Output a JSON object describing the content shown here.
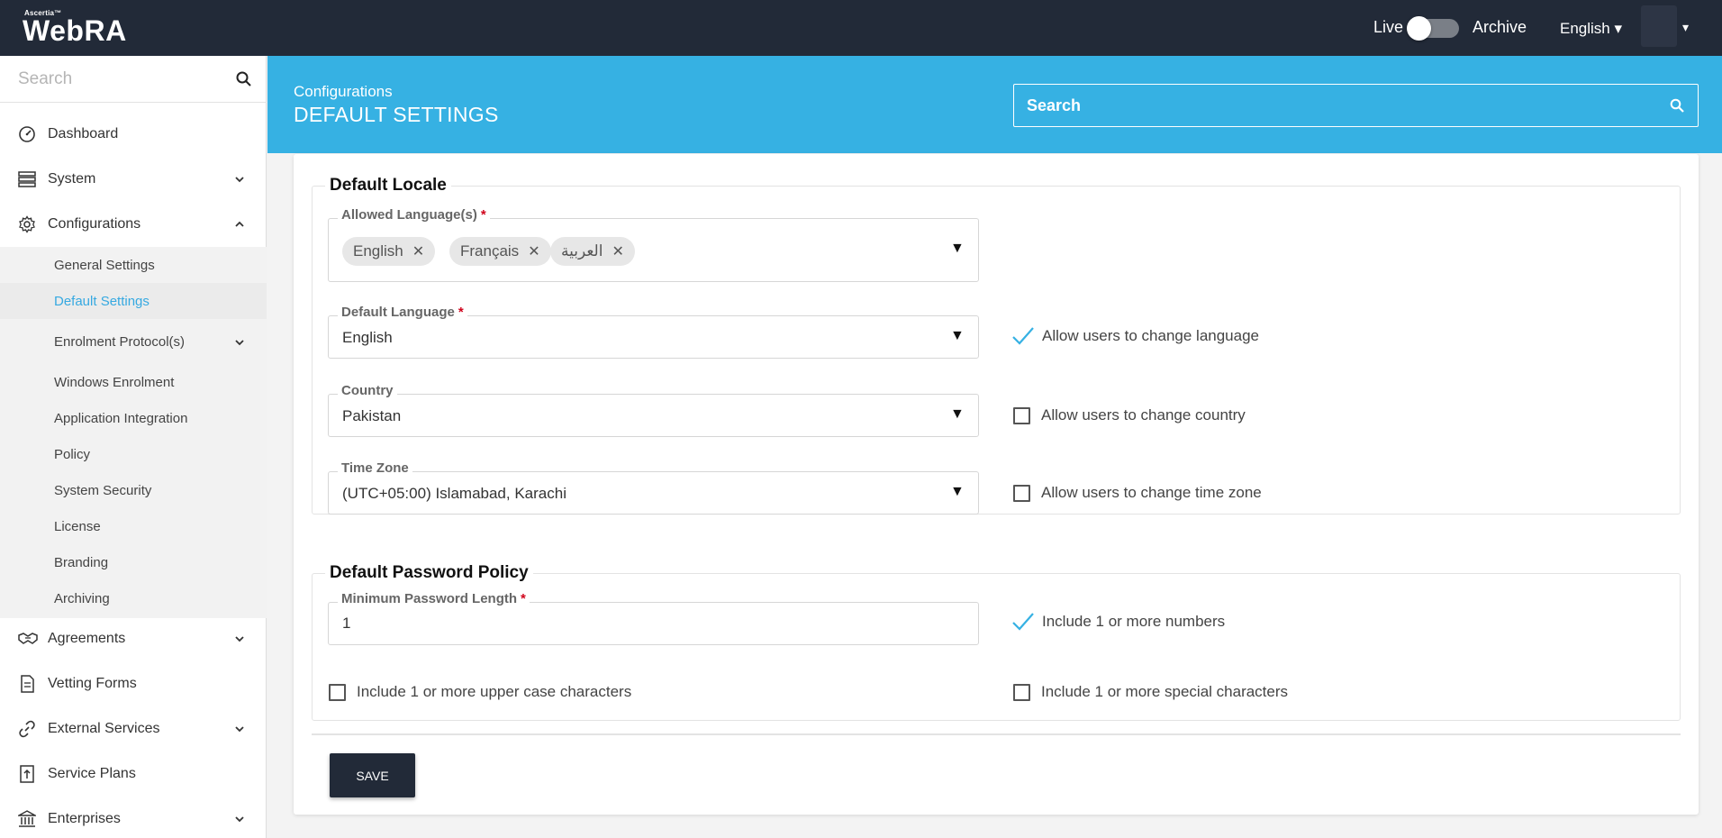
{
  "app": {
    "brand_small": "Ascertia™",
    "brand_name": "WebRA"
  },
  "topbar": {
    "live_label": "Live",
    "archive_label": "Archive",
    "language": "English ▾",
    "user_caret": "▾"
  },
  "sidebar": {
    "search_placeholder": "Search",
    "items": [
      {
        "label": "Dashboard",
        "icon": "dashboard-icon"
      },
      {
        "label": "System",
        "icon": "system-icon"
      },
      {
        "label": "Configurations",
        "icon": "gear-icon"
      },
      {
        "label": "Agreements",
        "icon": "handshake-icon"
      },
      {
        "label": "Vetting Forms",
        "icon": "form-icon"
      },
      {
        "label": "External Services",
        "icon": "link-icon"
      },
      {
        "label": "Service Plans",
        "icon": "upload-doc-icon"
      },
      {
        "label": "Enterprises",
        "icon": "bank-icon"
      }
    ],
    "sub_items": [
      {
        "label": "General Settings"
      },
      {
        "label": "Default Settings"
      },
      {
        "label": "Enrolment Protocol(s)"
      },
      {
        "label": "Windows Enrolment"
      },
      {
        "label": "Application Integration"
      },
      {
        "label": "Policy"
      },
      {
        "label": "System Security"
      },
      {
        "label": "License"
      },
      {
        "label": "Branding"
      },
      {
        "label": "Archiving"
      }
    ]
  },
  "header": {
    "breadcrumb": "Configurations",
    "title": "DEFAULT SETTINGS",
    "search_placeholder": "Search"
  },
  "locale": {
    "legend": "Default Locale",
    "allowed_label": "Allowed Language(s)",
    "required_mark": "*",
    "chips": [
      "English",
      "Français",
      "العربية"
    ],
    "chip_remove": "✕",
    "default_language_label": "Default Language",
    "default_language_value": "English",
    "country_label": "Country",
    "country_value": "Pakistan",
    "timezone_label": "Time Zone",
    "timezone_value": "(UTC+05:00) Islamabad, Karachi",
    "caret": "▼",
    "allow_language": "Allow users to change language",
    "allow_country": "Allow users to change country",
    "allow_timezone": "Allow users to change time zone"
  },
  "password": {
    "legend": "Default Password Policy",
    "min_length_label": "Minimum Password Length",
    "min_length_value": "1",
    "include_numbers": "Include 1 or more numbers",
    "include_upper": "Include 1 or more upper case characters",
    "include_special": "Include 1 or more special characters"
  },
  "actions": {
    "save_label": "SAVE"
  },
  "colors": {
    "topbar": "#222a38",
    "accent": "#36b1e3",
    "active_link": "#36a9e1",
    "required": "#d0021b"
  }
}
